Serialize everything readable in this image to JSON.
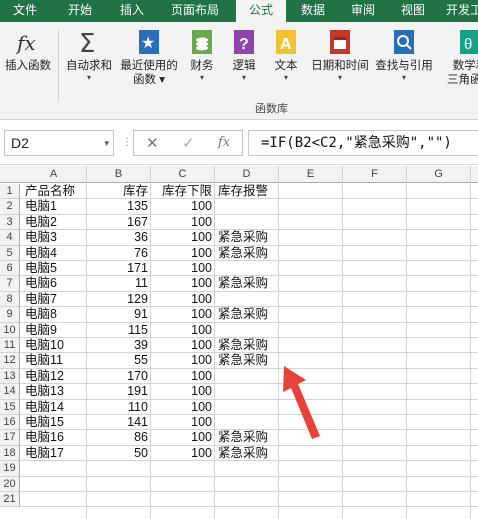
{
  "tabs": [
    "文件",
    "开始",
    "插入",
    "页面布局",
    "公式",
    "数据",
    "审阅",
    "视图",
    "开发工"
  ],
  "active_tab": "公式",
  "ribbon": {
    "insert_function": "插入函数",
    "autosum": "自动求和",
    "recent": "最近使用的函数",
    "recent_line1": "最近使用的",
    "recent_line2": "函数",
    "finance": "财务",
    "logic": "逻辑",
    "text": "文本",
    "datetime": "日期和时间",
    "lookup": "查找与引用",
    "math_line1": "数学和",
    "math_line2": "三角函数",
    "group_label": "函数库"
  },
  "formula_bar": {
    "name_box": "D2",
    "formula": "=IF(B2<C2,\"紧急采购\",\"\")"
  },
  "columns": [
    "A",
    "B",
    "C",
    "D",
    "E",
    "F",
    "G"
  ],
  "rows": [
    {
      "n": "1",
      "a": "产品名称",
      "b": "库存",
      "c": "库存下限",
      "d": "库存报警"
    },
    {
      "n": "2",
      "a": "电脑1",
      "b": "135",
      "c": "100",
      "d": ""
    },
    {
      "n": "3",
      "a": "电脑2",
      "b": "167",
      "c": "100",
      "d": ""
    },
    {
      "n": "4",
      "a": "电脑3",
      "b": "36",
      "c": "100",
      "d": "紧急采购"
    },
    {
      "n": "5",
      "a": "电脑4",
      "b": "76",
      "c": "100",
      "d": "紧急采购"
    },
    {
      "n": "6",
      "a": "电脑5",
      "b": "171",
      "c": "100",
      "d": ""
    },
    {
      "n": "7",
      "a": "电脑6",
      "b": "11",
      "c": "100",
      "d": "紧急采购"
    },
    {
      "n": "8",
      "a": "电脑7",
      "b": "129",
      "c": "100",
      "d": ""
    },
    {
      "n": "9",
      "a": "电脑8",
      "b": "91",
      "c": "100",
      "d": "紧急采购"
    },
    {
      "n": "10",
      "a": "电脑9",
      "b": "115",
      "c": "100",
      "d": ""
    },
    {
      "n": "11",
      "a": "电脑10",
      "b": "39",
      "c": "100",
      "d": "紧急采购"
    },
    {
      "n": "12",
      "a": "电脑11",
      "b": "55",
      "c": "100",
      "d": "紧急采购"
    },
    {
      "n": "13",
      "a": "电脑12",
      "b": "170",
      "c": "100",
      "d": ""
    },
    {
      "n": "14",
      "a": "电脑13",
      "b": "191",
      "c": "100",
      "d": ""
    },
    {
      "n": "15",
      "a": "电脑14",
      "b": "110",
      "c": "100",
      "d": ""
    },
    {
      "n": "16",
      "a": "电脑15",
      "b": "141",
      "c": "100",
      "d": ""
    },
    {
      "n": "17",
      "a": "电脑16",
      "b": "86",
      "c": "100",
      "d": "紧急采购"
    },
    {
      "n": "18",
      "a": "电脑17",
      "b": "50",
      "c": "100",
      "d": "紧急采购"
    },
    {
      "n": "19",
      "a": "",
      "b": "",
      "c": "",
      "d": ""
    },
    {
      "n": "20",
      "a": "",
      "b": "",
      "c": "",
      "d": ""
    },
    {
      "n": "21",
      "a": "",
      "b": "",
      "c": "",
      "d": ""
    }
  ],
  "colors": {
    "accent": "#217346",
    "arrow": "#e8413a"
  }
}
